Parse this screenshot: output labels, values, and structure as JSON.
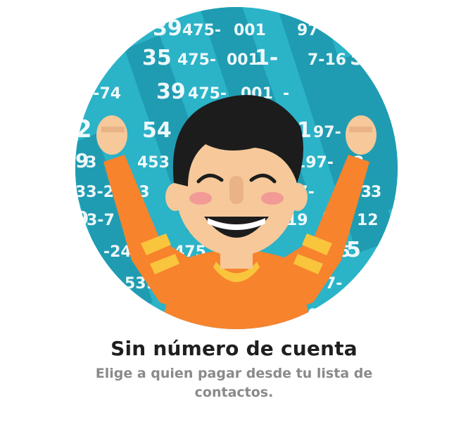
{
  "colors": {
    "background": "#ffffff",
    "circle": "#2bb3c8",
    "stripe": "#1f9bb1",
    "title": "#1f1f1f",
    "subtitle": "#8a8a8a",
    "shirt": "#f7832d",
    "shirt_stripe": "#f9c53d",
    "skin": "#f6c89a",
    "hair": "#1c1c1c"
  },
  "illustration": {
    "icon": "celebrating-person-illustration"
  },
  "onboarding": {
    "title": "Sin número de cuenta",
    "subtitle": "Elige a quien pagar desde tu lista de contactos."
  }
}
